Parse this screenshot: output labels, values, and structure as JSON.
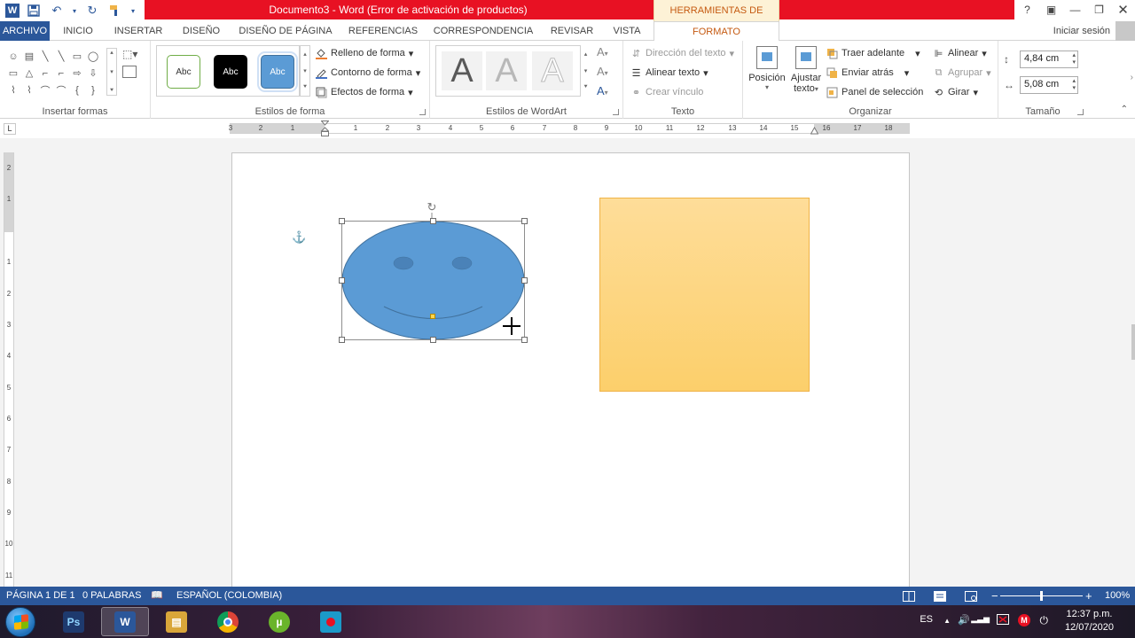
{
  "title_bar": {
    "document_title": "Documento3 -  Word (Error de activación de productos)",
    "contextual_tab_group": "HERRAMIENTAS DE DIBUJO",
    "help": "?",
    "ribbon_display": "▣",
    "minimize": "—",
    "restore": "❐",
    "close": "✕"
  },
  "quick_access": {
    "word_icon": "W",
    "save_icon": "floppy-icon",
    "undo_icon": "↶",
    "undo_dropdown": "▾",
    "redo_icon": "↻",
    "paint_icon": "brush-icon",
    "customize": "▾"
  },
  "tabs": [
    {
      "id": "archivo",
      "label": "ARCHIVO"
    },
    {
      "id": "inicio",
      "label": "INICIO"
    },
    {
      "id": "insertar",
      "label": "INSERTAR"
    },
    {
      "id": "diseno",
      "label": "DISEÑO"
    },
    {
      "id": "diseno-pagina",
      "label": "DISEÑO DE PÁGINA"
    },
    {
      "id": "referencias",
      "label": "REFERENCIAS"
    },
    {
      "id": "correspondencia",
      "label": "CORRESPONDENCIA"
    },
    {
      "id": "revisar",
      "label": "REVISAR"
    },
    {
      "id": "vista",
      "label": "VISTA"
    },
    {
      "id": "formato",
      "label": "FORMATO"
    }
  ],
  "signin": "Iniciar sesión",
  "ribbon": {
    "insert_shapes": {
      "label": "Insertar formas",
      "shape_glyphs": [
        "☺",
        "▤",
        "╲",
        "╲",
        "▭",
        "◯",
        "",
        "▭",
        "△",
        "⌐",
        "⌐",
        "⇨",
        "⇩",
        "",
        "⌇",
        "⌇",
        "⌒",
        "⌒",
        "{",
        "}",
        ""
      ],
      "scroll_up": "▴",
      "scroll_down": "▾",
      "scroll_more": "⯆",
      "edit_icon": "⬚▾"
    },
    "shape_styles": {
      "label": "Estilos de forma",
      "swatch_text": "Abc",
      "fill": "Relleno de forma",
      "outline": "Contorno de forma",
      "effects": "Efectos de forma",
      "dropdown": "▾",
      "scroll_up": "▴",
      "scroll_down": "▾",
      "scroll_more": "⯆"
    },
    "wordart": {
      "label": "Estilos de WordArt",
      "letter": "A",
      "scroll_up": "▴",
      "scroll_down": "▾",
      "scroll_more": "⯆",
      "text_fill_icon": "A",
      "text_outline_icon": "A",
      "text_effects_icon": "A",
      "dropdown": "▾"
    },
    "text": {
      "label": "Texto",
      "direction": "Dirección del texto",
      "align": "Alinear texto",
      "link": "Crear vínculo",
      "dropdown": "▾"
    },
    "arrange": {
      "label": "Organizar",
      "position_label": "Posición",
      "wrap_label": "Ajustar",
      "wrap_label2": "texto",
      "bring_forward": "Traer adelante",
      "send_backward": "Enviar atrás",
      "selection_pane": "Panel de selección",
      "align": "Alinear",
      "group": "Agrupar",
      "rotate": "Girar",
      "dropdown": "▾"
    },
    "size": {
      "label": "Tamaño",
      "height": "4,84 cm",
      "width": "5,08 cm",
      "spin_up": "▴",
      "spin_down": "▾"
    },
    "collapse": "⌃"
  },
  "ruler": {
    "corner": "L",
    "labels": [
      "3",
      "2",
      "1",
      "1",
      "2",
      "3",
      "4",
      "5",
      "6",
      "7",
      "8",
      "9",
      "10",
      "11",
      "12",
      "13",
      "14",
      "15",
      "16",
      "17",
      "18"
    ],
    "vertical_labels": [
      "2",
      "1",
      "1",
      "2",
      "3",
      "4",
      "5",
      "6",
      "7",
      "8",
      "9",
      "10",
      "11"
    ]
  },
  "document": {
    "anchor_icon": "⚓",
    "rotate_icon": "↻"
  },
  "colors": {
    "word_blue": "#2b579a",
    "title_red": "#e81123",
    "format_orange": "#c55a11",
    "smiley_fill": "#5b9bd5",
    "rect_fill": "#fdd78a"
  },
  "status": {
    "page": "PÁGINA 1 DE 1",
    "words": "0 PALABRAS",
    "proof_icon": "📖",
    "language": "ESPAÑOL (COLOMBIA)",
    "zoom_minus": "−",
    "zoom_plus": "+",
    "zoom": "100%"
  },
  "taskbar": {
    "apps": [
      {
        "name": "photoshop",
        "glyph": "Ps",
        "color": "#1e3a6e"
      },
      {
        "name": "word",
        "glyph": "W",
        "color": "#2b579a"
      },
      {
        "name": "explorer",
        "glyph": "▤",
        "color": "#d9a63a"
      },
      {
        "name": "chrome",
        "glyph": "◉",
        "color": "#db4437"
      },
      {
        "name": "utorrent",
        "glyph": "µ",
        "color": "#6ab42b"
      },
      {
        "name": "recorder",
        "glyph": "◉",
        "color": "#1b9ac9"
      }
    ],
    "language": "ES",
    "tray_up": "▲",
    "volume": "🔊",
    "signal": "▂▃▅",
    "time": "12:37 p.m.",
    "date": "12/07/2020"
  }
}
